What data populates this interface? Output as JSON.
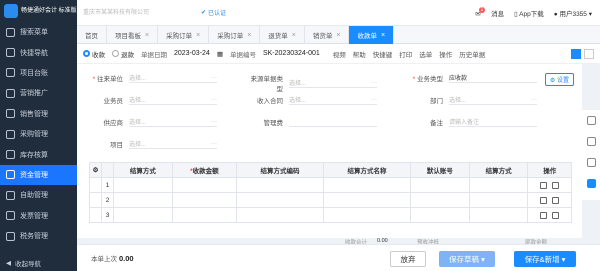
{
  "sidebar": {
    "brand": "畅捷通好会计\n标准版",
    "items": [
      {
        "label": "搜索菜单",
        "icon": "search-icon"
      },
      {
        "label": "快捷导航",
        "icon": "compass-icon"
      },
      {
        "label": "项目台账",
        "icon": "ledger-icon"
      },
      {
        "label": "营销推广",
        "icon": "megaphone-icon"
      },
      {
        "label": "销售管理",
        "icon": "cart-icon"
      },
      {
        "label": "采购管理",
        "icon": "box-icon"
      },
      {
        "label": "库存核算",
        "icon": "warehouse-icon"
      },
      {
        "label": "资金管理",
        "icon": "money-icon"
      },
      {
        "label": "自助管理",
        "icon": "user-icon"
      },
      {
        "label": "发票管理",
        "icon": "invoice-icon"
      },
      {
        "label": "税务管理",
        "icon": "tax-icon"
      }
    ],
    "active_index": 7,
    "collapse_label": "收起导航"
  },
  "topbar": {
    "company": "重庆市某某科技有限公司",
    "verified": "已认证",
    "message": "消息",
    "message_badge": "1",
    "app_download": "App下载",
    "user": "用户3355"
  },
  "tabs": [
    {
      "label": "首页",
      "closable": false
    },
    {
      "label": "项目看板",
      "closable": true
    },
    {
      "label": "采购订单",
      "closable": true
    },
    {
      "label": "采购订单",
      "closable": true
    },
    {
      "label": "退货单",
      "closable": true
    },
    {
      "label": "销货单",
      "closable": true
    },
    {
      "label": "收款单",
      "closable": true,
      "active": true
    }
  ],
  "toolbar": {
    "radio_receive": "收款",
    "radio_refund": "退款",
    "date_label": "单据日期",
    "date_value": "2023-03-24",
    "code_label": "单据编号",
    "code_value": "SK-20230324-001",
    "buttons": [
      "视频",
      "帮助",
      "快捷键",
      "打印",
      "选单",
      "操作",
      "历史单据"
    ]
  },
  "form": {
    "fields": [
      {
        "label": "往来单位",
        "required": true,
        "placeholder": "选择..."
      },
      {
        "label": "来源单据类型",
        "required": false,
        "placeholder": "选择..."
      },
      {
        "label": "业务类型",
        "required": true,
        "value": "应收款"
      },
      {
        "label": "业务员",
        "required": false,
        "placeholder": "选择..."
      },
      {
        "label": "收入合同",
        "required": false,
        "placeholder": "选择..."
      },
      {
        "label": "部门",
        "required": false,
        "placeholder": "选择..."
      },
      {
        "label": "供应商",
        "required": false,
        "placeholder": "选择..."
      },
      {
        "label": "管理费",
        "required": false,
        "placeholder": ""
      },
      {
        "label": "备注",
        "required": false,
        "placeholder": "请输入备注"
      },
      {
        "label": "项目",
        "required": false,
        "placeholder": "选择..."
      }
    ],
    "settings_label": "设置"
  },
  "grid": {
    "headers": [
      "结算方式",
      "收款金额",
      "结算方式编码",
      "结算方式名称",
      "默认账号",
      "结算方式",
      "操作"
    ],
    "required": [
      false,
      true,
      false,
      false,
      false,
      false,
      false
    ],
    "rows": [
      "1",
      "2",
      "3"
    ]
  },
  "summary": {
    "amount_label": "收款合计",
    "amount": "0.00",
    "prev_label": "预收冲抵",
    "balance_label": "尾款金额"
  },
  "footer": {
    "prev_label": "本单上次",
    "prev_value": "0.00",
    "discard": "放弃",
    "save_draft": "保存草稿",
    "save_new": "保存&新增"
  }
}
